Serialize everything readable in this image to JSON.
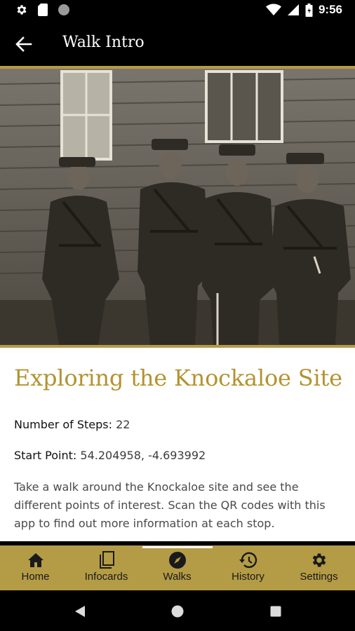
{
  "status_bar": {
    "time": "9:56",
    "left_icons": [
      "gear-icon",
      "sd-card-icon",
      "circle-icon"
    ],
    "right_icons": [
      "wifi-icon",
      "signal-icon",
      "battery-icon"
    ]
  },
  "app_bar": {
    "title": "Walk Intro",
    "back_icon": "arrow-left-icon"
  },
  "walk": {
    "title": "Exploring the Knockaloe Site",
    "steps_label": "Number of Steps:",
    "steps_value": "22",
    "start_label": "Start Point:",
    "start_value": "54.204958, -4.693992",
    "description": "Take a walk around the Knockaloe site and see the different points of interest. Scan the QR codes with this app to find out more information at each stop."
  },
  "bottom_nav": {
    "items": [
      {
        "label": "Home",
        "icon": "home-icon"
      },
      {
        "label": "Infocards",
        "icon": "cards-icon"
      },
      {
        "label": "Walks",
        "icon": "compass-icon",
        "active": true
      },
      {
        "label": "History",
        "icon": "history-icon"
      },
      {
        "label": "Settings",
        "icon": "gear-icon"
      }
    ]
  },
  "colors": {
    "accent": "#b49b45",
    "title_gold": "#b3932f",
    "nav_bg": "#b49b45"
  }
}
